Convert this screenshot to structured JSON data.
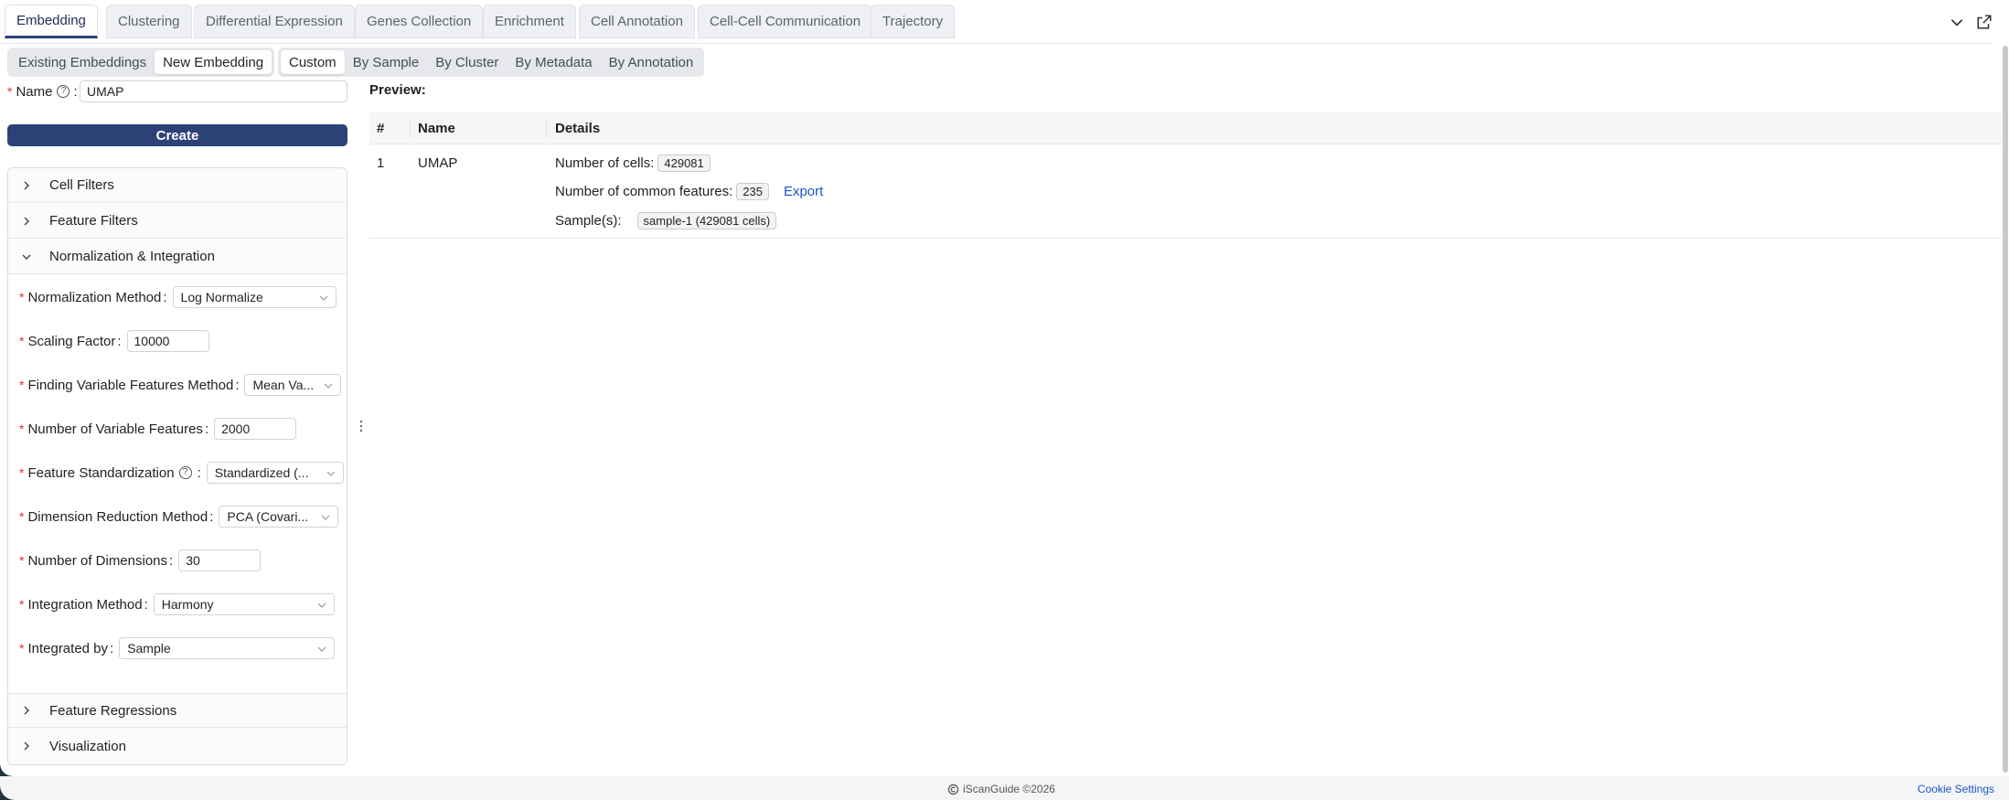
{
  "top_tabs": [
    {
      "label": "Embedding",
      "active": true
    },
    {
      "label": "Clustering",
      "active": false
    },
    {
      "label": "Differential Expression",
      "active": false
    },
    {
      "label": "Genes Collection",
      "active": false
    },
    {
      "label": "Enrichment",
      "active": false
    },
    {
      "label": "Cell Annotation",
      "active": false
    },
    {
      "label": "Cell-Cell Communication",
      "active": false
    },
    {
      "label": "Trajectory",
      "active": false
    }
  ],
  "mode_tabs": [
    {
      "label": "Existing Embeddings",
      "active": false
    },
    {
      "label": "New Embedding",
      "active": true
    }
  ],
  "source_tabs": [
    {
      "label": "Custom",
      "active": true
    },
    {
      "label": "By Sample",
      "active": false
    },
    {
      "label": "By Cluster",
      "active": false
    },
    {
      "label": "By Metadata",
      "active": false
    },
    {
      "label": "By Annotation",
      "active": false
    }
  ],
  "form": {
    "name_label": "Name",
    "name_value": "UMAP",
    "create_label": "Create",
    "sections": {
      "cell_filters": "Cell Filters",
      "feature_filters": "Feature Filters",
      "normalization": "Normalization & Integration",
      "feature_regressions": "Feature Regressions",
      "visualization": "Visualization"
    },
    "fields": {
      "normalization_method": {
        "label": "Normalization Method",
        "value": "Log Normalize"
      },
      "scaling_factor": {
        "label": "Scaling Factor",
        "value": "10000"
      },
      "variable_method": {
        "label": "Finding Variable Features Method",
        "value": "Mean Va..."
      },
      "num_variable": {
        "label": "Number of Variable Features",
        "value": "2000"
      },
      "standardization": {
        "label": "Feature Standardization",
        "value": "Standardized (..."
      },
      "dim_reduction": {
        "label": "Dimension Reduction Method",
        "value": "PCA (Covari..."
      },
      "num_dims": {
        "label": "Number of Dimensions",
        "value": "30"
      },
      "integration_method": {
        "label": "Integration Method",
        "value": "Harmony"
      },
      "integrated_by": {
        "label": "Integrated by",
        "value": "Sample"
      }
    }
  },
  "preview": {
    "title": "Preview:",
    "columns": [
      "#",
      "Name",
      "Details"
    ],
    "row": {
      "index": "1",
      "name": "UMAP",
      "cells_label": "Number of cells:",
      "cells_value": "429081",
      "features_label": "Number of common features:",
      "features_value": "235",
      "export_label": "Export",
      "samples_label": "Sample(s):",
      "sample_tag": "sample-1 (429081 cells)"
    }
  },
  "footer": {
    "copyright": "iScanGuide ©2026",
    "cookie_settings": "Cookie Settings"
  },
  "colors": {
    "primary": "#2c4277",
    "link": "#1a56c9",
    "required": "#e0312f"
  }
}
